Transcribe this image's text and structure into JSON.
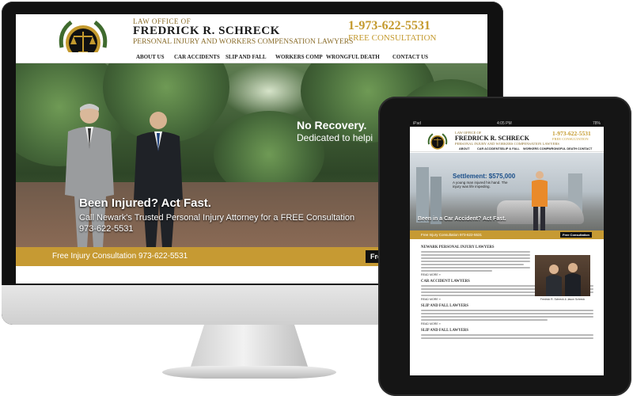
{
  "desktop": {
    "header": {
      "office": "LAW OFFICE OF",
      "firm_name": "FREDRICK R. SCHRECK",
      "tagline": "PERSONAL INJURY AND WORKERS COMPENSATION LAWYERS",
      "phone": "1-973-622-5531",
      "free_consultation": "FREE CONSULTATION"
    },
    "nav": [
      "ABOUT US",
      "CAR ACCIDENTS",
      "SLIP AND FALL",
      "WORKERS COMP",
      "WRONGFUL DEATH",
      "CONTACT US"
    ],
    "hero": {
      "tagline_1": "No Recovery.",
      "tagline_2": "Dedicated to helpi",
      "title": "Been Injured? Act Fast.",
      "subtitle": "Call Newark's Trusted Personal Injury Attorney for a FREE Consultation",
      "phone": "973-622-5531"
    },
    "consult_bar": {
      "text": "Free Injury Consultation 973-622-5531",
      "button": "Free"
    }
  },
  "tablet": {
    "status": {
      "carrier": "iPad",
      "time": "4:05 PM",
      "battery": "78%"
    },
    "header": {
      "office": "LAW OFFICE OF",
      "firm_name": "FREDRICK R. SCHRECK",
      "tagline": "PERSONAL INJURY AND WORKERS COMPENSATION LAWYERS",
      "phone": "1-973-622-5531",
      "free_consultation": "FREE CONSULTATION"
    },
    "nav": [
      "ABOUT",
      "CAR ACCIDENTS",
      "SLIP & FALL",
      "WORKERS COMP",
      "WRONGFUL DEATH",
      "CONTACT"
    ],
    "hero": {
      "settlement": "Settlement: $575,000",
      "settlement_sub": "A young man injured his hand. The injury was life impeding.",
      "accident": "Been in a Car Accident? Act Fast."
    },
    "consult_bar": {
      "text": "Free Injury Consultation 973-622-5531",
      "button": "Free Consultation"
    },
    "content": {
      "heading_1": "NEWARK PERSONAL INJURY LAWYERS",
      "heading_2": "CAR ACCIDENT LAWYERS",
      "heading_3": "SLIP AND FALL LAWYERS",
      "heading_4": "SLIP AND FALL LAWYERS",
      "read_more": "READ MORE »",
      "photo_caption": "Fredrick R. Schreck & Jason Schreck"
    }
  },
  "colors": {
    "gold": "#c69a33",
    "gold_text": "#c49a2e",
    "dark": "#111111",
    "blue_accent": "#1b4f8a"
  },
  "icons": [
    "scales-of-justice-logo",
    "laurel-wreath"
  ]
}
